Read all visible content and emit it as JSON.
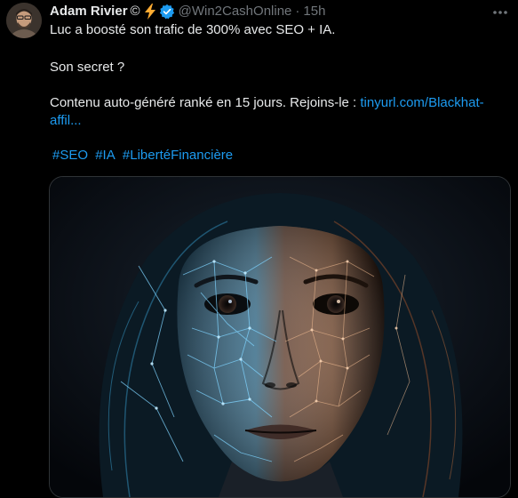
{
  "tweet": {
    "author": {
      "name": "Adam Rivier",
      "emoji": "©",
      "handle": "@Win2CashOnline",
      "separator": "·",
      "time": "15h",
      "verified": true,
      "avatar_icon": "avatar-person-icon"
    },
    "text": {
      "line1": "Luc a boosté son trafic de 300% avec SEO + IA.",
      "line2": "Son secret ?",
      "line3_prefix": "Contenu auto-généré ranké en 15 jours. Rejoins-le : ",
      "line3_link_a": "tinyurl.com/Blackhat-",
      "line3_link_b": "affil..."
    },
    "hashtags": [
      "#SEO",
      "#IA",
      "#LibertéFinancière"
    ],
    "media": {
      "icon": "ai-face-network-image"
    },
    "colors": {
      "background": "#000000",
      "text": "#e7e9ea",
      "secondary": "#71767b",
      "link": "#1d9bf0",
      "verified": "#1d9bf0",
      "bolt": "#ffac33"
    }
  }
}
